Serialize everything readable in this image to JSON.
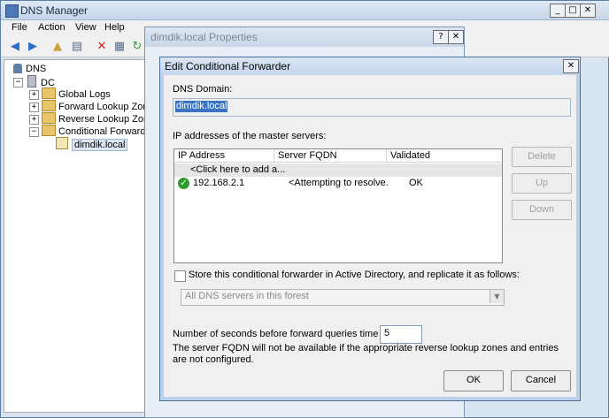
{
  "main_window": {
    "title": "DNS Manager",
    "controls": {
      "minimize": "_",
      "maximize": "□",
      "close": "✕"
    }
  },
  "menubar": [
    "File",
    "Action",
    "View",
    "Help"
  ],
  "toolbar_icons": [
    "back-arrow-icon",
    "forward-arrow-icon",
    "up-folder-icon",
    "show-hide-tree-icon",
    "delete-icon",
    "properties-icon",
    "refresh-icon"
  ],
  "tree": {
    "root": "DNS",
    "server": "DC",
    "items": [
      "Global Logs",
      "Forward Lookup Zones",
      "Reverse Lookup Zones",
      "Conditional Forwarders"
    ],
    "selected_child": "dimdik.local"
  },
  "properties_window": {
    "title": "dimdik.local Properties",
    "help": "?",
    "close": "✕"
  },
  "dialog": {
    "title": "Edit Conditional Forwarder",
    "close": "✕",
    "dns_domain_label": "DNS Domain:",
    "dns_domain_value": "dimdik.local",
    "master_servers_label": "IP addresses of the master servers:",
    "columns": [
      "IP Address",
      "Server FQDN",
      "Validated"
    ],
    "add_row_placeholder": "<Click here to add a...",
    "rows": [
      {
        "ip": "192.168.2.1",
        "fqdn": "<Attempting to resolve...",
        "validated": "OK"
      }
    ],
    "buttons": {
      "delete": "Delete",
      "up": "Up",
      "down": "Down",
      "ok": "OK",
      "cancel": "Cancel"
    },
    "store_ad_label": "Store this conditional forwarder in Active Directory, and replicate it as follows:",
    "store_ad_checked": false,
    "replication_selected": "All DNS servers in this forest",
    "timeout_label": "Number of seconds before forward queries time out:",
    "timeout_value": "5",
    "note": "The server FQDN will not be available if the appropriate reverse lookup zones and entries are not configured."
  },
  "colors": {
    "title_gradient": "#c4d5ec",
    "selection": "#3a73c4",
    "ok_icon": "#2f9b2f"
  }
}
